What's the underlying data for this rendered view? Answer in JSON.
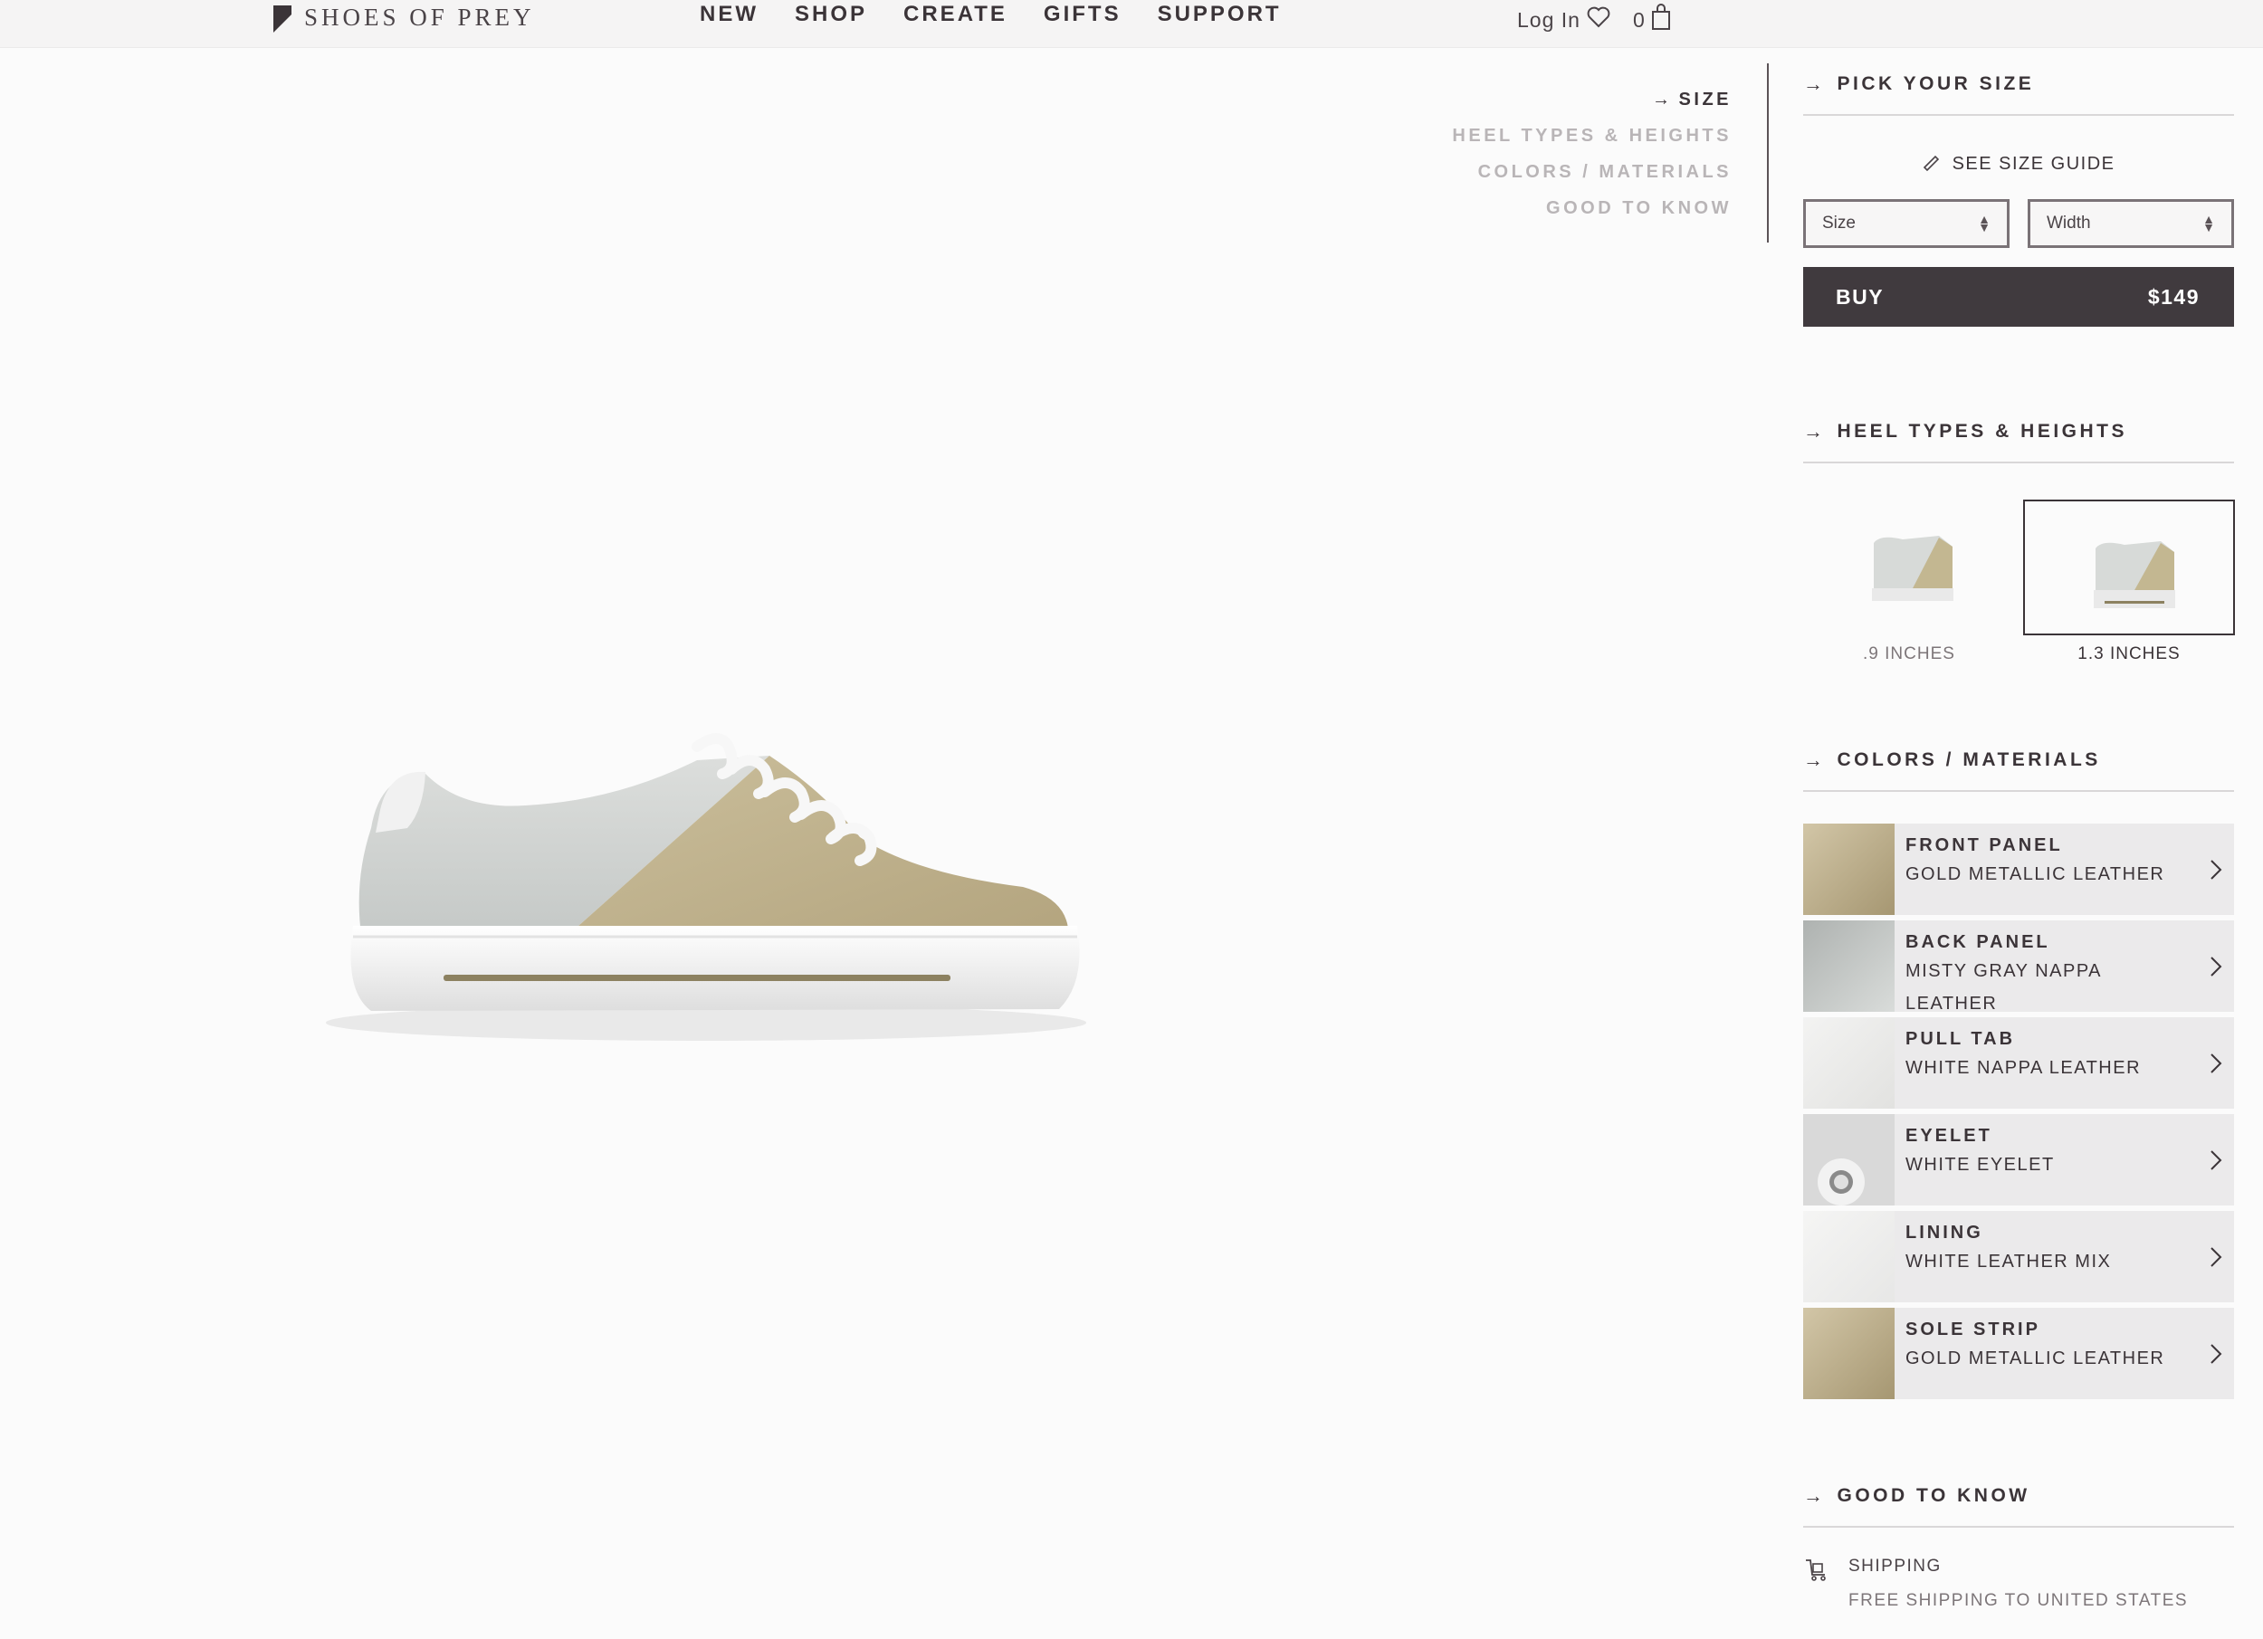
{
  "brand": {
    "name": "SHOES OF PREY"
  },
  "nav": {
    "items": [
      "NEW",
      "SHOP",
      "CREATE",
      "GIFTS",
      "SUPPORT"
    ]
  },
  "account": {
    "login": "Log In",
    "cart_count": "0"
  },
  "section_nav": {
    "items": [
      {
        "label": "SIZE",
        "active": true
      },
      {
        "label": "HEEL TYPES & HEIGHTS",
        "active": false
      },
      {
        "label": "COLORS / MATERIALS",
        "active": false
      },
      {
        "label": "GOOD TO KNOW",
        "active": false
      }
    ]
  },
  "size_section": {
    "title": "PICK YOUR SIZE",
    "size_guide": "SEE SIZE GUIDE",
    "size_select": "Size",
    "width_select": "Width",
    "buy_label": "BUY",
    "price": "$149"
  },
  "heel_section": {
    "title": "HEEL TYPES & HEIGHTS",
    "options": [
      {
        "label": ".9 INCHES",
        "selected": false
      },
      {
        "label": "1.3 INCHES",
        "selected": true
      }
    ]
  },
  "materials_section": {
    "title": "COLORS / MATERIALS",
    "items": [
      {
        "name": "FRONT PANEL",
        "value": "GOLD METALLIC LEATHER",
        "swatch": "#b9a985"
      },
      {
        "name": "BACK PANEL",
        "value": "MISTY GRAY NAPPA LEATHER",
        "swatch": "#c3c6c4"
      },
      {
        "name": "PULL TAB",
        "value": "WHITE NAPPA LEATHER",
        "swatch": "#eeeeec"
      },
      {
        "name": "EYELET",
        "value": "WHITE EYELET",
        "swatch": "#dcdcdc"
      },
      {
        "name": "LINING",
        "value": "WHITE LEATHER MIX",
        "swatch": "#f1f1f0"
      },
      {
        "name": "SOLE STRIP",
        "value": "GOLD METALLIC LEATHER",
        "swatch": "#b9a985"
      }
    ]
  },
  "good_to_know": {
    "title": "GOOD TO KNOW",
    "shipping_label": "SHIPPING",
    "shipping_value": "FREE SHIPPING TO UNITED STATES"
  },
  "colors": {
    "accent_dark": "#403a3e",
    "text": "#3b3438",
    "muted": "#b9b5b7"
  }
}
